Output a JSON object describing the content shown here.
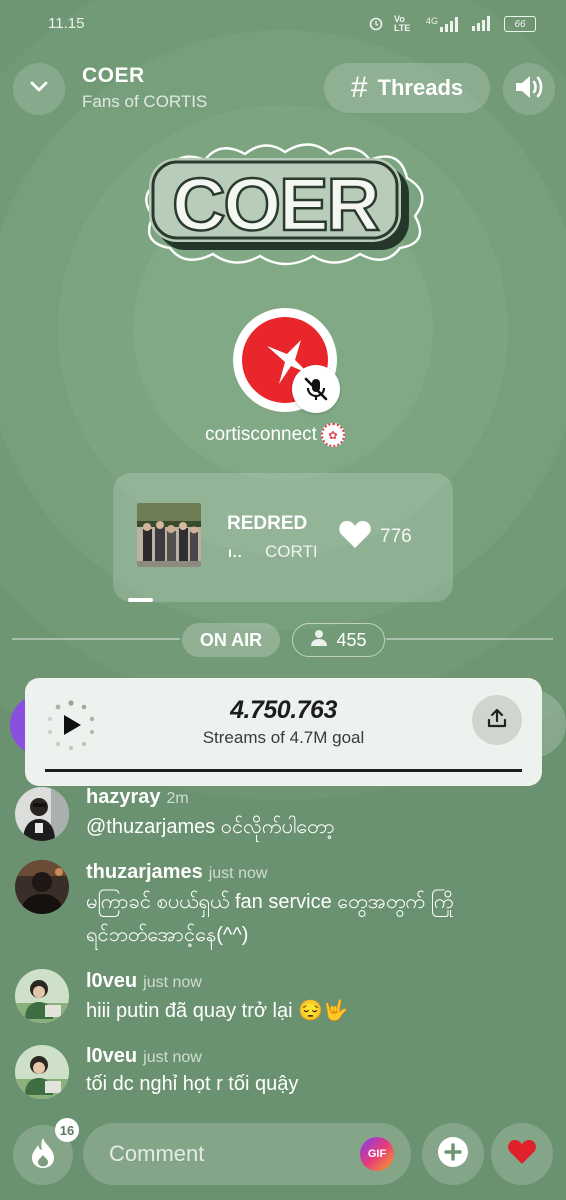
{
  "status_bar": {
    "time": "11.15",
    "network": "Vo LTE",
    "signal": "4G",
    "battery": "66"
  },
  "header": {
    "title": "COER",
    "subtitle": "Fans of CORTIS",
    "threads_label": "Threads",
    "threads_icon": "hash-icon"
  },
  "logo": {
    "text": "COER"
  },
  "host": {
    "username": "cortisconnect",
    "muted": true
  },
  "now_playing": {
    "title": "REDRED",
    "artist": "CORTIS",
    "likes": "776"
  },
  "live": {
    "on_air_label": "ON AIR",
    "listeners": "455"
  },
  "stream_goal": {
    "count": "4.750.763",
    "caption": "Streams of 4.7M goal"
  },
  "comments": [
    {
      "username": "hazyray",
      "time": "2m",
      "lines": [
        "@thuzarjames ဝင်လိုက်ပါတော့"
      ]
    },
    {
      "username": "thuzarjames",
      "time": "just now",
      "lines": [
        "မကြာခင် စပယ်ရှယ် fan service တွေအတွက် ကြို",
        "ရင်ဘတ်အောင့်နေ(^^)"
      ]
    },
    {
      "username": "l0veu",
      "time": "just now",
      "lines": [
        "hiii putin đã quay trở lại 😔🤟"
      ]
    },
    {
      "username": "l0veu",
      "time": "just now",
      "lines": [
        "tối dc nghỉ họt r tối quậy"
      ]
    }
  ],
  "bottom_bar": {
    "fire_count": "16",
    "comment_placeholder": "Comment",
    "gif_label": "GIF"
  },
  "colors": {
    "background": "#6e9573",
    "brand_red": "#e8262b",
    "goal_card": "#eef2ee",
    "gif_gradient": "#e63a7a"
  }
}
